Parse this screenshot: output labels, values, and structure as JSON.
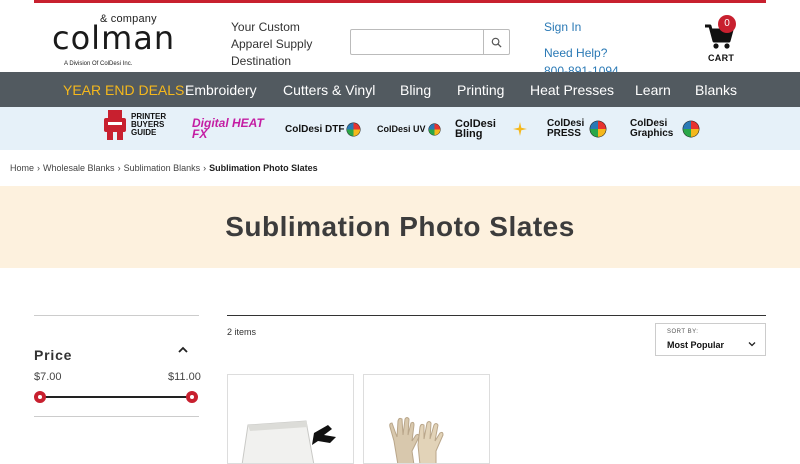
{
  "header": {
    "logo_small": "& company",
    "logo_brand": "colman",
    "logo_division": "A Division Of ColDesi Inc.",
    "tagline": "Your Custom Apparel Supply Destination",
    "search_placeholder": "",
    "sign_in": "Sign In",
    "help_label": "Need Help?",
    "phone": "800-891-1094",
    "cart_count": "0",
    "cart_label": "CART"
  },
  "nav": {
    "items": [
      "YEAR END DEALS",
      "Embroidery",
      "Cutters & Vinyl",
      "Bling",
      "Printing",
      "Heat Presses",
      "Learn",
      "Blanks"
    ]
  },
  "brands": {
    "items": [
      "PRINTER BUYERS GUIDE",
      "Digital HEAT FX",
      "ColDesi DTF",
      "ColDesi UV",
      "ColDesi Bling",
      "ColDesi PRESS",
      "ColDesi Graphics"
    ]
  },
  "breadcrumb": {
    "items": [
      "Home",
      "Wholesale Blanks",
      "Sublimation Blanks"
    ],
    "current": "Sublimation Photo Slates"
  },
  "page": {
    "title": "Sublimation Photo Slates"
  },
  "filters": {
    "price_title": "Price",
    "price_min": "$7.00",
    "price_max": "$11.00"
  },
  "results": {
    "count": "2 items",
    "sort_label": "SORT BY:",
    "sort_value": "Most Popular"
  },
  "colors": {
    "accent_red": "#c8202f",
    "nav_bg": "#525a60",
    "deal_yellow": "#f5b81c",
    "hero_bg": "#fdf1de",
    "brand_strip_bg": "#e6f1f9",
    "link_blue": "#2a79b5"
  }
}
